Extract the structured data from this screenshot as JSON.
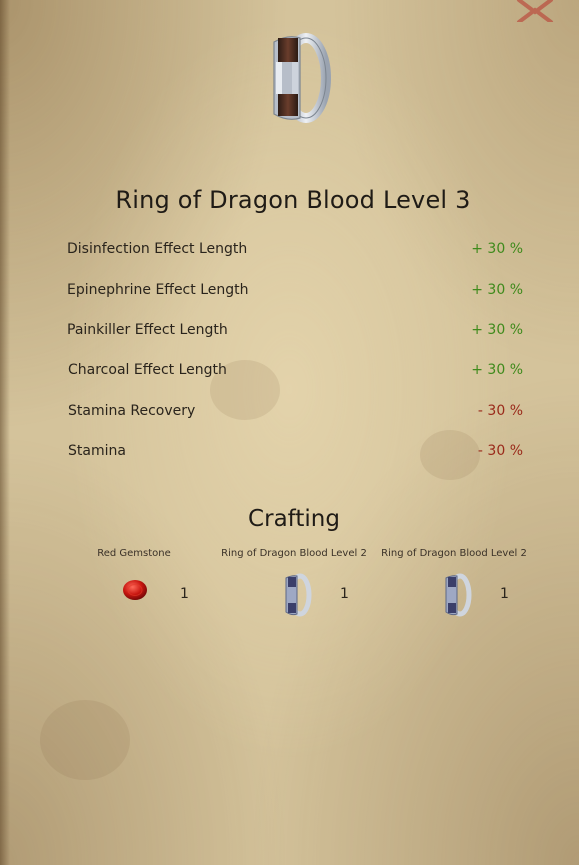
{
  "item": {
    "title": "Ring of Dragon Blood Level 3",
    "icon": "ring-icon"
  },
  "stats": [
    {
      "name": "Disinfection Effect Length",
      "value": "+ 30 %",
      "kind": "positive"
    },
    {
      "name": "Epinephrine Effect Length",
      "value": "+ 30 %",
      "kind": "positive"
    },
    {
      "name": "Painkiller Effect Length",
      "value": "+ 30 %",
      "kind": "positive"
    },
    {
      "name": "Charcoal Effect Length",
      "value": "+ 30 %",
      "kind": "positive"
    },
    {
      "name": "Stamina Recovery",
      "value": "- 30 %",
      "kind": "negative"
    },
    {
      "name": "Stamina",
      "value": "- 30 %",
      "kind": "negative"
    }
  ],
  "crafting": {
    "title": "Crafting",
    "ingredients": [
      {
        "name": "Red Gemstone",
        "quantity": "1",
        "icon": "red-gemstone-icon"
      },
      {
        "name": "Ring of Dragon Blood Level 2",
        "quantity": "1",
        "icon": "ring-icon"
      },
      {
        "name": "Ring of Dragon Blood Level 2",
        "quantity": "1",
        "icon": "ring-icon"
      }
    ]
  },
  "colors": {
    "positive": "#3f8a1c",
    "negative": "#9a2a1a",
    "close": "#b8322a"
  }
}
